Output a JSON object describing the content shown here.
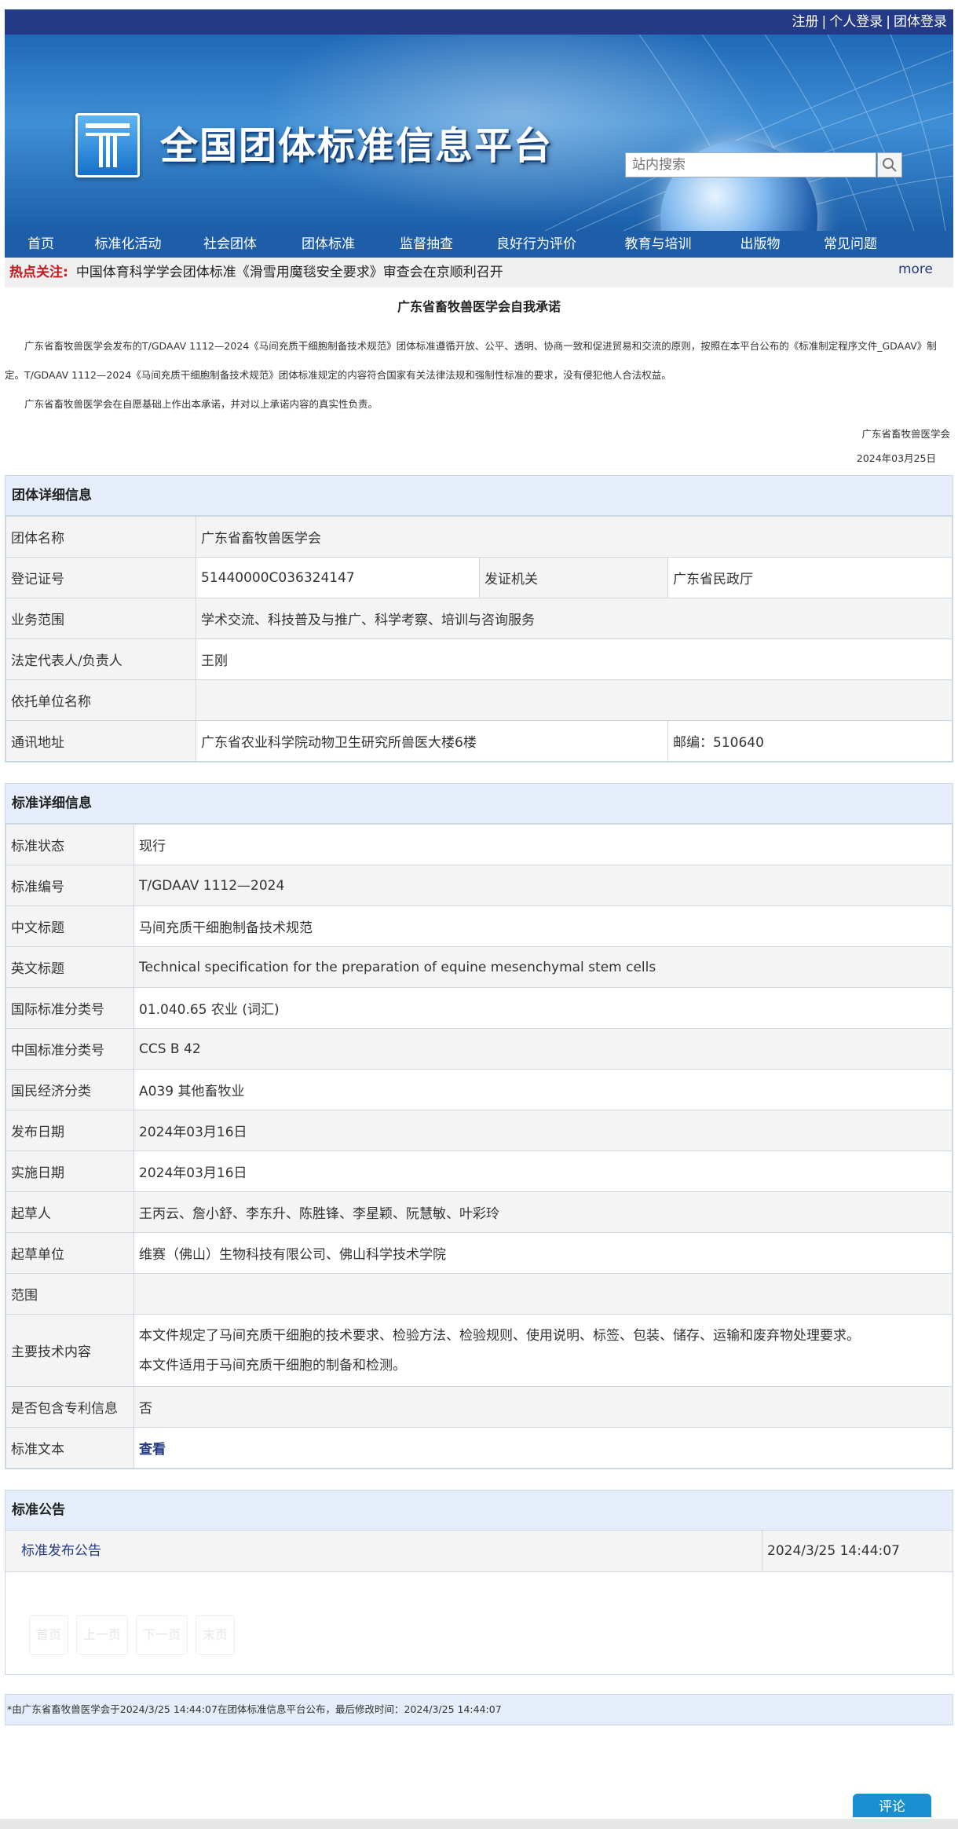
{
  "topbar": {
    "register": "注册",
    "personal_login": "个人登录",
    "group_login": "团体登录",
    "separator": "|"
  },
  "header": {
    "site_title": "全国团体标准信息平台",
    "search_placeholder": "站内搜索"
  },
  "nav": [
    "首页",
    "标准化活动",
    "社会团体",
    "团体标准",
    "监督抽查",
    "良好行为评价",
    "教育与培训",
    "出版物",
    "常见问题"
  ],
  "hot": {
    "label": "热点关注:",
    "text": "中国体育科学学会团体标准《滑雪用魔毯安全要求》审查会在京顺利召开",
    "more": "more"
  },
  "promise": {
    "title": "广东省畜牧兽医学会自我承诺",
    "para1": "广东省畜牧兽医学会发布的T/GDAAV 1112—2024《马间充质干细胞制备技术规范》团体标准遵循开放、公平、透明、协商一致和促进贸易和交流的原则，按照在本平台公布的《标准制定程序文件_GDAAV》制定。T/GDAAV 1112—2024《马间充质干细胞制备技术规范》团体标准规定的内容符合国家有关法律法规和强制性标准的要求，没有侵犯他人合法权益。",
    "para2": "广东省畜牧兽医学会在自愿基础上作出本承诺，并对以上承诺内容的真实性负责。",
    "signer": "广东省畜牧兽医学会",
    "date": "2024年03月25日"
  },
  "org": {
    "heading": "团体详细信息",
    "name_label": "团体名称",
    "name": "广东省畜牧兽医学会",
    "reg_label": "登记证号",
    "reg": "51440000C036324147",
    "issuer_label": "发证机关",
    "issuer": "广东省民政厅",
    "scope_label": "业务范围",
    "scope": "学术交流、科技普及与推广、科学考察、培训与咨询服务",
    "rep_label": "法定代表人/负责人",
    "rep": "王刚",
    "unit_label": "依托单位名称",
    "unit": "",
    "addr_label": "通讯地址",
    "addr": "广东省农业科学院动物卫生研究所兽医大楼6楼",
    "zip": "邮编：510640"
  },
  "std": {
    "heading": "标准详细信息",
    "rows": [
      {
        "k": "标准状态",
        "v": "现行"
      },
      {
        "k": "标准编号",
        "v": "T/GDAAV 1112—2024"
      },
      {
        "k": "中文标题",
        "v": "马间充质干细胞制备技术规范"
      },
      {
        "k": "英文标题",
        "v": "Technical specification for the preparation of equine mesenchymal stem cells"
      },
      {
        "k": "国际标准分类号",
        "v": "01.040.65 农业 (词汇)"
      },
      {
        "k": "中国标准分类号",
        "v": "CCS B 42"
      },
      {
        "k": "国民经济分类",
        "v": "A039 其他畜牧业"
      },
      {
        "k": "发布日期",
        "v": "2024年03月16日"
      },
      {
        "k": "实施日期",
        "v": "2024年03月16日"
      },
      {
        "k": "起草人",
        "v": "王丙云、詹小舒、李东升、陈胜锋、李星颖、阮慧敏、叶彩玲"
      },
      {
        "k": "起草单位",
        "v": "维赛（佛山）生物科技有限公司、佛山科学技术学院"
      },
      {
        "k": "范围",
        "v": ""
      }
    ],
    "tech_label": "主要技术内容",
    "tech1": "本文件规定了马间充质干细胞的技术要求、检验方法、检验规则、使用说明、标签、包装、储存、运输和废弃物处理要求。",
    "tech2": "本文件适用于马间充质干细胞的制备和检测。",
    "patent_label": "是否包含专利信息",
    "patent": "否",
    "text_label": "标准文本",
    "text_link": "查看"
  },
  "announce": {
    "heading": "标准公告",
    "item": "标准发布公告",
    "time": "2024/3/25 14:44:07",
    "pager": [
      "首页",
      "上一页",
      "下一页",
      "末页"
    ]
  },
  "footer_note": "*由广东省畜牧兽医学会于2024/3/25 14:44:07在团体标准信息平台公布，最后修改时间：2024/3/25 14:44:07",
  "comment_button": "评论"
}
